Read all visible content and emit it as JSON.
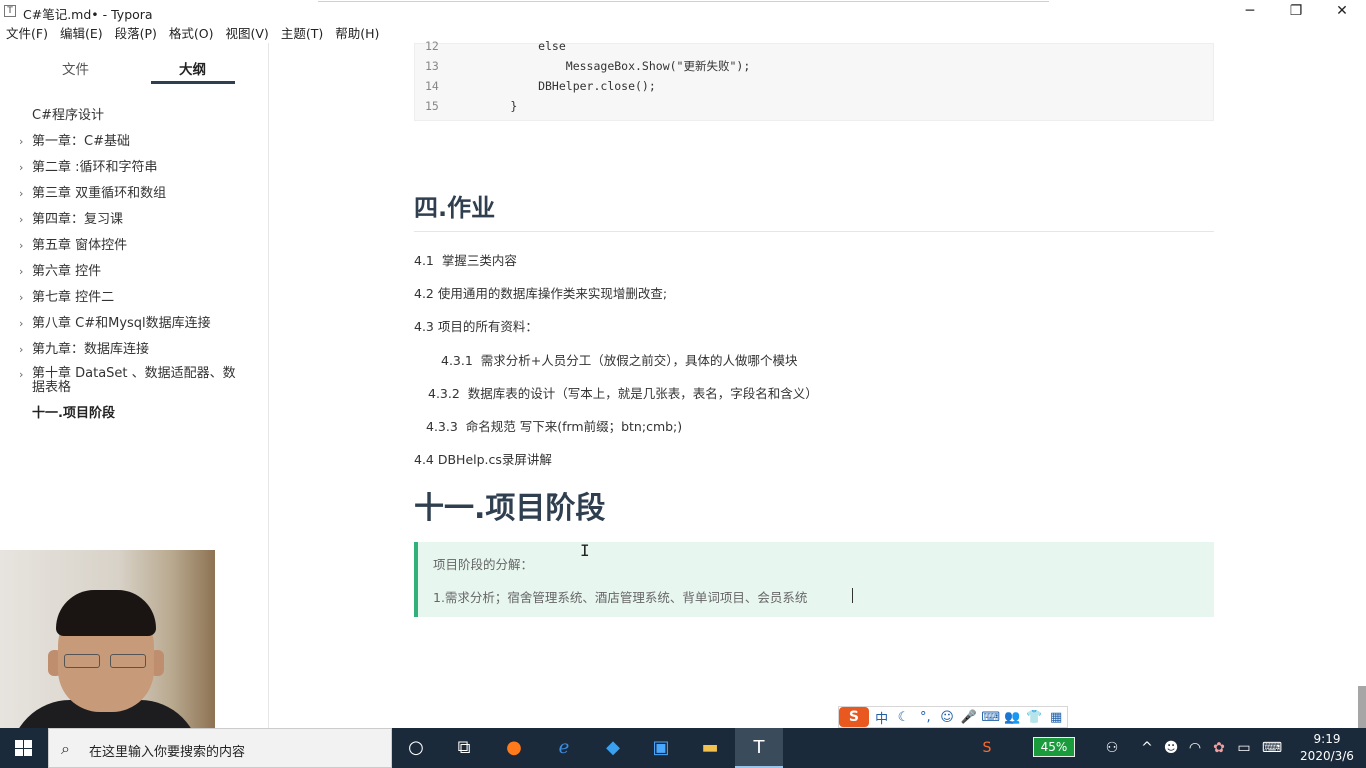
{
  "window": {
    "title": "C#笔记.md• - Typora",
    "app_icon": "T",
    "minimize": "─",
    "maximize": "❐",
    "close": "✕"
  },
  "menu": [
    "文件(F)",
    "编辑(E)",
    "段落(P)",
    "格式(O)",
    "视图(V)",
    "主题(T)",
    "帮助(H)"
  ],
  "sidebar": {
    "tabs": {
      "files": "文件",
      "outline": "大纲",
      "active": "outline"
    },
    "outline": [
      {
        "label": "C#程序设计",
        "chevron": false
      },
      {
        "label": "第一章：C#基础",
        "chevron": true
      },
      {
        "label": "第二章 :循环和字符串",
        "chevron": true
      },
      {
        "label": "第三章 双重循环和数组",
        "chevron": true
      },
      {
        "label": "第四章：复习课",
        "chevron": true
      },
      {
        "label": "第五章 窗体控件",
        "chevron": true
      },
      {
        "label": "第六章 控件",
        "chevron": true
      },
      {
        "label": "第七章 控件二",
        "chevron": true
      },
      {
        "label": "第八章 C#和Mysql数据库连接",
        "chevron": true
      },
      {
        "label": "第九章：数据库连接",
        "chevron": true
      },
      {
        "label": "第十章 DataSet 、数据适配器、数据表格",
        "chevron": true
      },
      {
        "label": "十一.项目阶段",
        "chevron": false,
        "active": true
      }
    ]
  },
  "code": {
    "lines": [
      {
        "n": "12",
        "text": "            else"
      },
      {
        "n": "13",
        "text": "                MessageBox.Show(\"更新失败\");"
      },
      {
        "n": "14",
        "text": "            DBHelper.close();"
      },
      {
        "n": "15",
        "text": "        }"
      }
    ]
  },
  "doc": {
    "h_section": "四.作业",
    "paras": [
      "4.1  掌握三类内容",
      "4.2 使用通用的数据库操作类来实现增删改查;",
      "4.3 项目的所有资料：",
      "4.3.1  需求分析+人员分工（放假之前交），具体的人做哪个模块",
      "4.3.2  数据库表的设计（写本上，就是几张表，表名，字段名和含义）",
      "4.3.3  命名规范 写下来(frm前缀；btn;cmb;)",
      "4.4 DBHelp.cs录屏讲解"
    ],
    "h_big": "十一.项目阶段",
    "quote": {
      "line1": "项目阶段的分解：",
      "line2": "1.需求分析；宿舍管理系统、酒店管理系统、背单词项目、会员系统"
    }
  },
  "ime": {
    "logo": "S",
    "items": [
      "中",
      "☾",
      "°,",
      "☺",
      "🎤",
      "⌨",
      "👥",
      "👕",
      "▦"
    ]
  },
  "taskbar": {
    "search_placeholder": "在这里输入你要搜索的内容",
    "battery": "45%",
    "time": "9:19",
    "date": "2020/3/6"
  }
}
